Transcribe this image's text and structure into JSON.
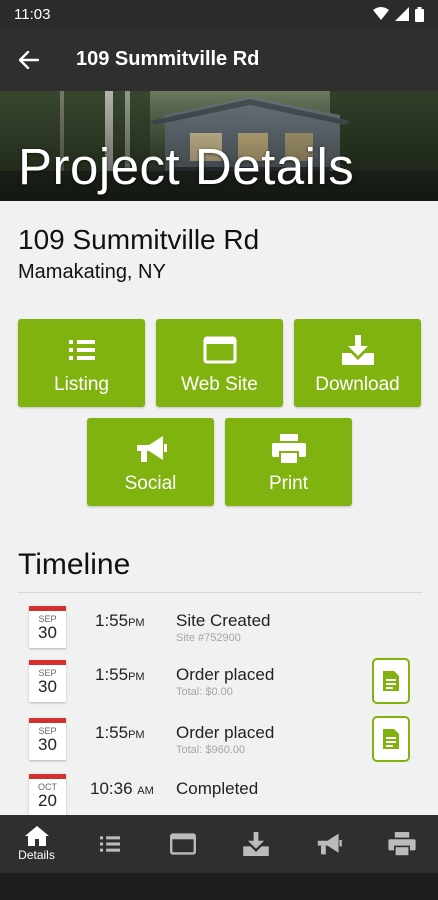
{
  "status_bar": {
    "time": "11:03"
  },
  "app_bar": {
    "title": "109 Summitville Rd"
  },
  "hero": {
    "title": "Project Details"
  },
  "property": {
    "address": "109 Summitville Rd",
    "city": "Mamakating, NY"
  },
  "actions": [
    {
      "label": "Listing",
      "icon": "list-icon"
    },
    {
      "label": "Web Site",
      "icon": "browser-window-icon"
    },
    {
      "label": "Download",
      "icon": "download-icon"
    },
    {
      "label": "Social",
      "icon": "megaphone-icon"
    },
    {
      "label": "Print",
      "icon": "printer-icon"
    }
  ],
  "timeline": {
    "title": "Timeline",
    "events": [
      {
        "month": "SEP",
        "day": "30",
        "time": "1:55",
        "ampm": "PM",
        "title": "Site Created",
        "subtitle": "Site #752900",
        "has_doc": false
      },
      {
        "month": "SEP",
        "day": "30",
        "time": "1:55",
        "ampm": "PM",
        "title": "Order placed",
        "subtitle": "Total: $0.00",
        "has_doc": true
      },
      {
        "month": "SEP",
        "day": "30",
        "time": "1:55",
        "ampm": "PM",
        "title": "Order placed",
        "subtitle": "Total: $960.00",
        "has_doc": true
      },
      {
        "month": "OCT",
        "day": "20",
        "time": "10:36",
        "ampm": "AM",
        "title": "Completed",
        "subtitle": "",
        "has_doc": false
      }
    ]
  },
  "bottom_nav": {
    "details_label": "Details",
    "items": [
      "home-icon",
      "list-icon",
      "browser-window-icon",
      "download-icon",
      "megaphone-icon",
      "printer-icon"
    ]
  },
  "colors": {
    "accent": "#80b310",
    "bar": "#2f2f2f",
    "calendar_red": "#d32f2f"
  }
}
